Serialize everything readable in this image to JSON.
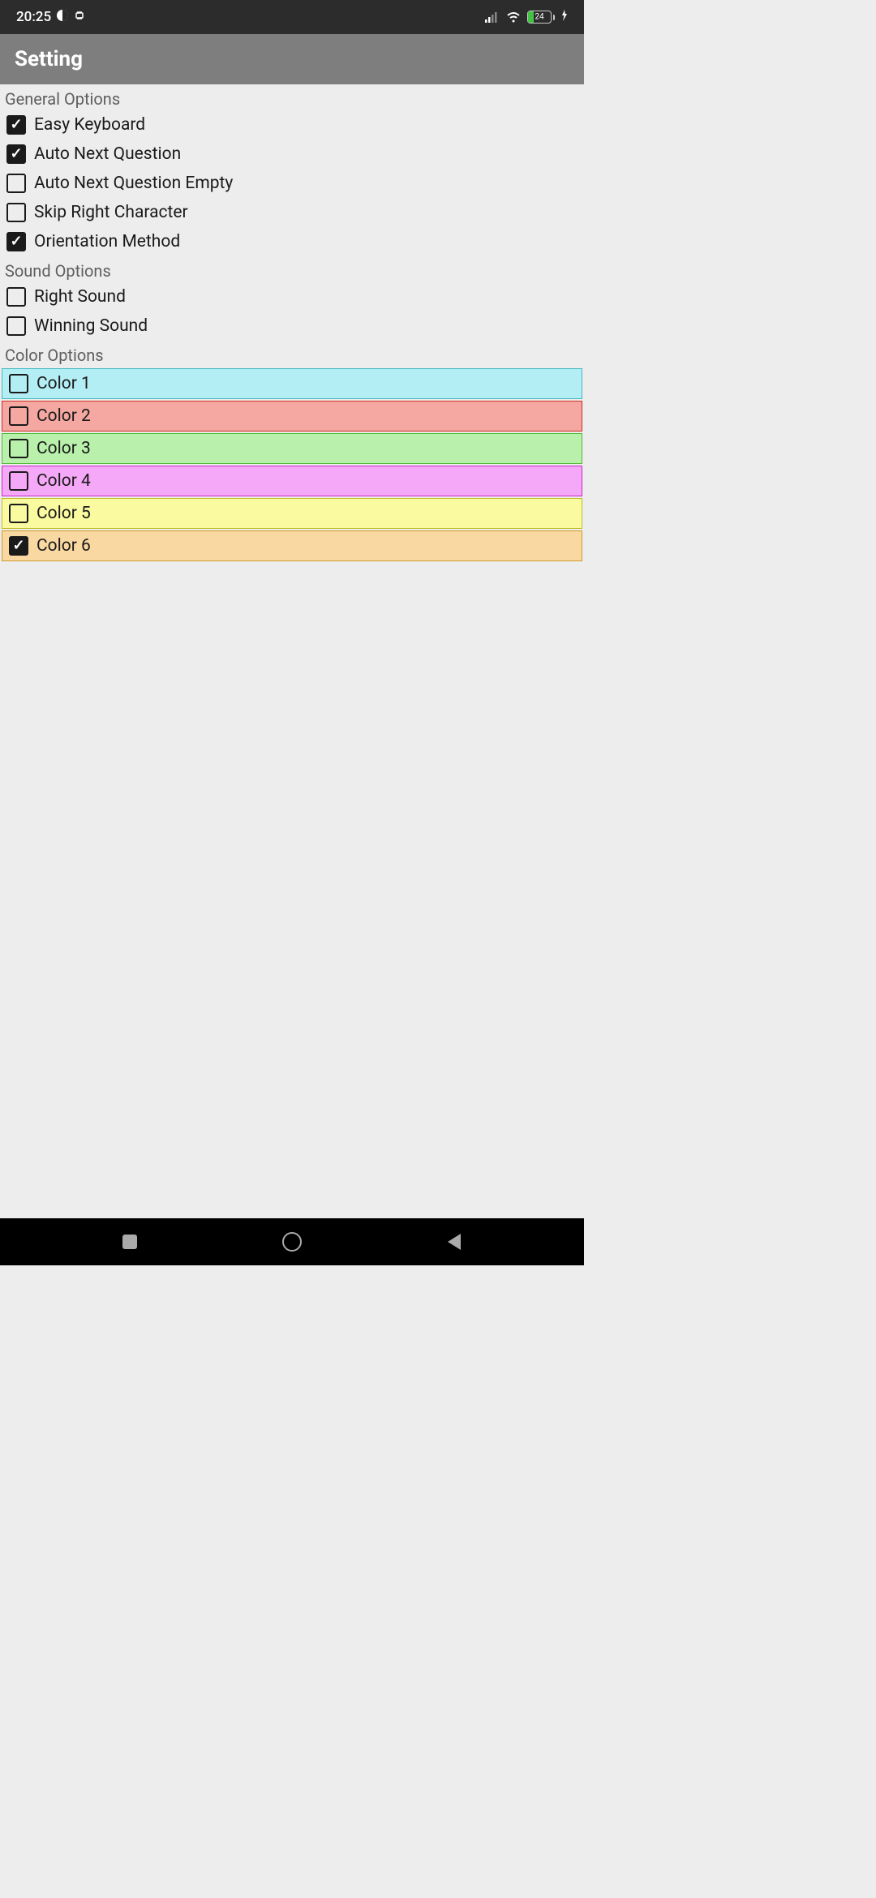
{
  "status_bar": {
    "time": "20:25",
    "battery_percent": "24"
  },
  "app_bar": {
    "title": "Setting"
  },
  "sections": {
    "general": {
      "header": "General Options",
      "items": [
        {
          "label": "Easy Keyboard",
          "checked": true
        },
        {
          "label": "Auto Next Question",
          "checked": true
        },
        {
          "label": "Auto Next Question Empty",
          "checked": false
        },
        {
          "label": "Skip Right Character",
          "checked": false
        },
        {
          "label": "Orientation Method",
          "checked": true
        }
      ]
    },
    "sound": {
      "header": "Sound Options",
      "items": [
        {
          "label": "Right Sound",
          "checked": false
        },
        {
          "label": "Winning Sound",
          "checked": false
        }
      ]
    },
    "color": {
      "header": "Color Options",
      "items": [
        {
          "label": "Color 1",
          "checked": false,
          "bg": "#b3eef4",
          "border": "#46b9c2"
        },
        {
          "label": "Color 2",
          "checked": false,
          "bg": "#f4a8a1",
          "border": "#ce2f23"
        },
        {
          "label": "Color 3",
          "checked": false,
          "bg": "#b9f0ab",
          "border": "#4eba35"
        },
        {
          "label": "Color 4",
          "checked": false,
          "bg": "#f5a8f7",
          "border": "#c528c9"
        },
        {
          "label": "Color 5",
          "checked": false,
          "bg": "#fafaa0",
          "border": "#bdbb24"
        },
        {
          "label": "Color 6",
          "checked": true,
          "bg": "#f9d8a2",
          "border": "#ce9b2b"
        }
      ]
    }
  }
}
